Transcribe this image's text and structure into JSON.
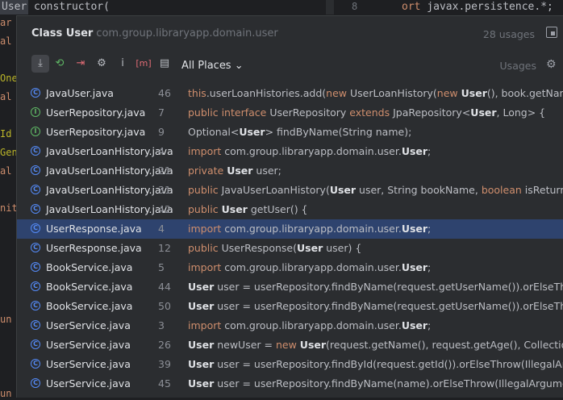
{
  "editor": {
    "selected_word": "User",
    "left_line": " constructor(",
    "right_line_number": "8",
    "right_line_kw": "ort",
    "right_line_rest": " javax.persistence.*;",
    "gutter": [
      "ar",
      "al",
      "",
      "One",
      "al",
      "",
      "Id",
      "Gen",
      "al",
      "",
      "nit",
      "",
      "",
      "",
      "",
      "",
      "un",
      "",
      "",
      "",
      "un"
    ]
  },
  "popup": {
    "title": "Class User",
    "package": "com.group.libraryapp.domain.user",
    "usage_count": "28 usages",
    "scope": "All Places",
    "usages_label": "Usages",
    "toolbar_icons": [
      "merge-icon",
      "read-access-icon",
      "write-access-icon",
      "settings-filter-icon",
      "info-icon",
      "method-icon",
      "preview-icon"
    ],
    "rows": [
      {
        "file": "JavaUser.java",
        "line": "46",
        "icon": "class",
        "html": "<span class='k'>this</span>.userLoanHistories.add(<span class='k'>new</span> UserLoanHistory(<span class='k'>new</span> <span class='b'>User</span>(), book.getName(), <span class='k'>false</span>, nu"
      },
      {
        "file": "UserRepository.java",
        "line": "7",
        "icon": "interface",
        "html": "<span class='k'>public interface</span> UserRepository <span class='k'>extends</span> JpaRepository&lt;<span class='b'>User</span>, Long&gt; {"
      },
      {
        "file": "UserRepository.java",
        "line": "9",
        "icon": "interface",
        "html": "Optional&lt;<span class='b'>User</span>&gt; findByName(String name);"
      },
      {
        "file": "JavaUserLoanHistory.java",
        "line": "4",
        "icon": "class",
        "html": "<span class='k'>import</span> com.group.libraryapp.domain.user.<span class='b'>User</span>;"
      },
      {
        "file": "JavaUserLoanHistory.java",
        "line": "21",
        "icon": "class",
        "html": "<span class='k'>private</span> <span class='b'>User</span> user;"
      },
      {
        "file": "JavaUserLoanHistory.java",
        "line": "31",
        "icon": "class",
        "html": "<span class='k'>public</span> JavaUserLoanHistory(<span class='b'>User</span> user, String bookName, <span class='k'>boolean</span> isReturn) {"
      },
      {
        "file": "JavaUserLoanHistory.java",
        "line": "42",
        "icon": "class",
        "html": "<span class='k'>public</span> <span class='b'>User</span> getUser() {"
      },
      {
        "file": "UserResponse.java",
        "line": "4",
        "icon": "class",
        "selected": true,
        "html": "<span class='k'>import</span> com.group.libraryapp.domain.user.<span class='b'>User</span>;"
      },
      {
        "file": "UserResponse.java",
        "line": "12",
        "icon": "class",
        "html": "<span class='k'>public</span> UserResponse(<span class='b'>User</span> user) {"
      },
      {
        "file": "BookService.java",
        "line": "5",
        "icon": "class",
        "html": "<span class='k'>import</span> com.group.libraryapp.domain.user.<span class='b'>User</span>;"
      },
      {
        "file": "BookService.java",
        "line": "44",
        "icon": "class",
        "html": "<span class='b'>User</span> user = userRepository.findByName(request.getUserName()).orElseThrow(IllegalArg"
      },
      {
        "file": "BookService.java",
        "line": "50",
        "icon": "class",
        "html": "<span class='b'>User</span> user = userRepository.findByName(request.getUserName()).orElseThrow(IllegalArg"
      },
      {
        "file": "UserService.java",
        "line": "3",
        "icon": "class",
        "html": "<span class='k'>import</span> com.group.libraryapp.domain.user.<span class='b'>User</span>;"
      },
      {
        "file": "UserService.java",
        "line": "26",
        "icon": "class",
        "html": "<span class='b'>User</span> newUser = <span class='k'>new</span> <span class='b'>User</span>(request.getName(), request.getAge(), Collections.emptyList"
      },
      {
        "file": "UserService.java",
        "line": "39",
        "icon": "class",
        "html": "<span class='b'>User</span> user = userRepository.findById(request.getId()).orElseThrow(IllegalArgumentExcep"
      },
      {
        "file": "UserService.java",
        "line": "45",
        "icon": "class",
        "html": "<span class='b'>User</span> user = userRepository.findByName(name).orElseThrow(IllegalArgumentException"
      }
    ]
  },
  "colors": {
    "accent": "#548af7",
    "selected_row": "#2e436e",
    "keyword": "#cf8e6d",
    "interface": "#5fb865"
  }
}
